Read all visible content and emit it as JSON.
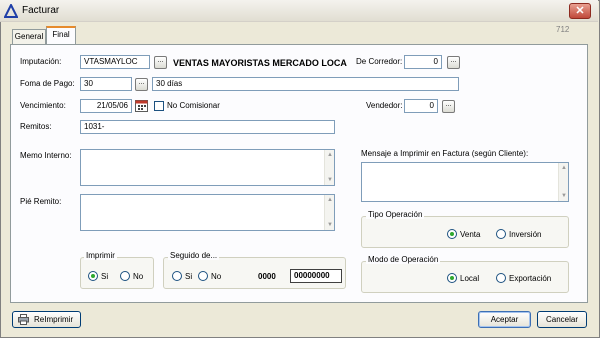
{
  "window": {
    "title": "Facturar",
    "form_code": "712"
  },
  "tabs": [
    {
      "label": "General"
    },
    {
      "label": "Final"
    }
  ],
  "fields": {
    "imputacion": {
      "label": "Imputación:",
      "value": "VTASMAYLOC",
      "name": "VENTAS MAYORISTAS MERCADO LOCA"
    },
    "corredor": {
      "label": "De Corredor:",
      "value": "0"
    },
    "forma_pago": {
      "label": "Foma de Pago:",
      "value": "30",
      "description": "30 días"
    },
    "vencimiento": {
      "label": "Vencimiento:",
      "value": "21/05/06"
    },
    "no_comisionar": {
      "label": "No Comisionar"
    },
    "vendedor": {
      "label": "Vendedor:",
      "value": "0"
    },
    "remitos": {
      "label": "Remitos:",
      "value": "1031-"
    },
    "memo_interno": {
      "label": "Memo Interno:"
    },
    "pie_remito": {
      "label": "Pié Remito:"
    },
    "mensaje": {
      "label": "Mensaje a Imprimir en Factura (según Cliente):"
    }
  },
  "imprimir": {
    "title": "Imprimir",
    "options": [
      "Si",
      "No"
    ],
    "selected": "Si"
  },
  "seguido": {
    "title": "Seguido de...",
    "options": [
      "Si",
      "No"
    ],
    "prefix": "0000",
    "number": "00000000"
  },
  "tipo_operacion": {
    "title": "Tipo Operación",
    "options": [
      "Venta",
      "Inversión"
    ],
    "selected": "Venta"
  },
  "modo_operacion": {
    "title": "Modo de Operación",
    "options": [
      "Local",
      "Exportación"
    ],
    "selected": "Local"
  },
  "buttons": {
    "reimprimir": "ReImprimir",
    "aceptar": "Aceptar",
    "cancelar": "Cancelar",
    "dots": "..."
  },
  "colors": {
    "accent_tab": "#e68b2c",
    "radio_dot": "#2fa82f",
    "field_border": "#7f9db9"
  }
}
